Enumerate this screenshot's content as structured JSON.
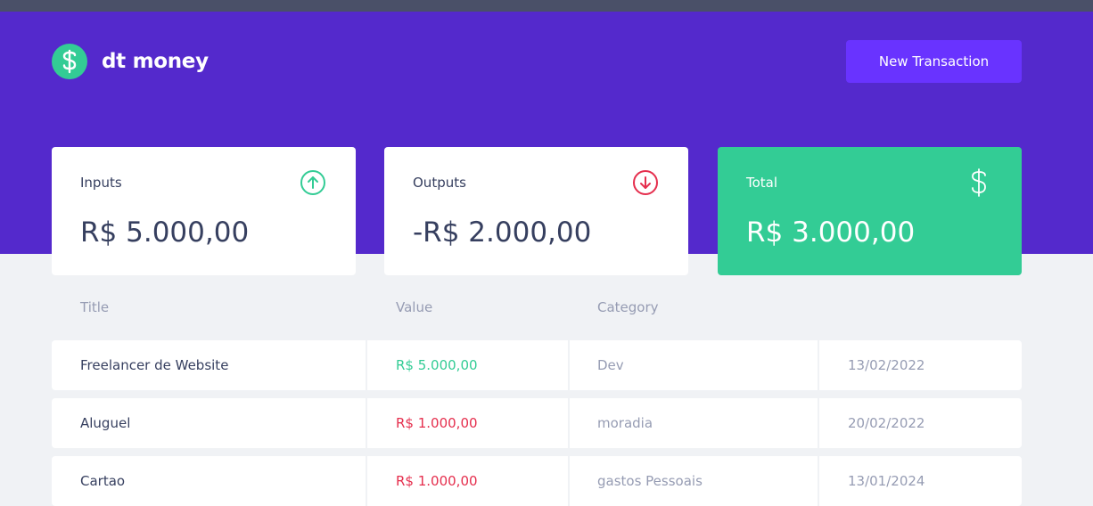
{
  "app": {
    "name": "dt money",
    "new_transaction_label": "New Transaction"
  },
  "summary": {
    "inputs": {
      "label": "Inputs",
      "value": "R$ 5.000,00",
      "icon": "arrow-up-circle-icon",
      "color": "#33cc95"
    },
    "outputs": {
      "label": "Outputs",
      "value": "-R$ 2.000,00",
      "icon": "arrow-down-circle-icon",
      "color": "#e52e4d"
    },
    "total": {
      "label": "Total",
      "value": "R$ 3.000,00",
      "icon": "dollar-icon",
      "color": "#33cc95"
    }
  },
  "table": {
    "headers": [
      "Title",
      "Value",
      "Category"
    ],
    "rows": [
      {
        "title": "Freelancer de Website",
        "value": "R$ 5.000,00",
        "type": "deposit",
        "category": "Dev",
        "date": "13/02/2022"
      },
      {
        "title": "Aluguel",
        "value": "R$ 1.000,00",
        "type": "withdraw",
        "category": "moradia",
        "date": "20/02/2022"
      },
      {
        "title": "Cartao",
        "value": "R$ 1.000,00",
        "type": "withdraw",
        "category": "gastos Pessoais",
        "date": "13/01/2024"
      }
    ]
  },
  "colors": {
    "header_bg": "#5429cc",
    "button_bg": "#6933ff",
    "green": "#33cc95",
    "red": "#e52e4d",
    "page_bg": "#f0f2f5",
    "text_title": "#363f5f",
    "text_muted": "#969cb3"
  }
}
